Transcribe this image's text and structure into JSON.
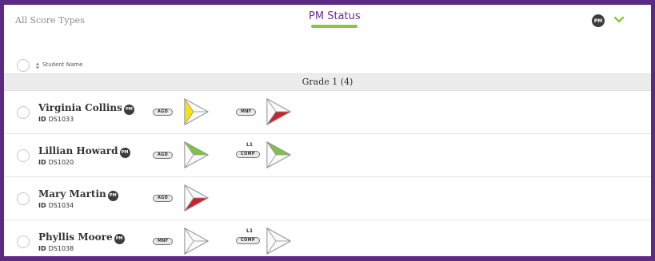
{
  "top": {
    "score_types_label": "All Score Types",
    "tab_label": "PM Status",
    "pm_badge": "PM"
  },
  "header": {
    "student_name_label": "Student Name"
  },
  "group": {
    "label": "Grade 1 (4)"
  },
  "id_prefix": "ID",
  "students": [
    {
      "name": "Virginia Collins",
      "id": "DS1033",
      "measures": [
        {
          "tag": "AGD",
          "level": "",
          "status": "yellow"
        },
        {
          "tag": "MNF",
          "level": "",
          "status": "red"
        }
      ]
    },
    {
      "name": "Lillian Howard",
      "id": "DS1020",
      "measures": [
        {
          "tag": "AGD",
          "level": "",
          "status": "green"
        },
        {
          "tag": "COMP",
          "level": "L1",
          "status": "green"
        }
      ]
    },
    {
      "name": "Mary Martin",
      "id": "DS1034",
      "measures": [
        {
          "tag": "AGD",
          "level": "",
          "status": "red"
        }
      ]
    },
    {
      "name": "Phyllis Moore",
      "id": "DS1038",
      "measures": [
        {
          "tag": "MNF",
          "level": "",
          "status": "none"
        },
        {
          "tag": "COMP",
          "level": "L1",
          "status": "none"
        }
      ]
    }
  ],
  "colors": {
    "accent_purple": "#6a2d91",
    "accent_green": "#8bc53f",
    "status_green": "#7dc243",
    "status_red": "#c1272d",
    "status_yellow": "#f2e21c"
  },
  "icons": {
    "pm_toggle": "pm-circle-icon",
    "expand": "chevron-down-icon",
    "sort": "sort-icon",
    "status": "triangle-status-icon"
  }
}
